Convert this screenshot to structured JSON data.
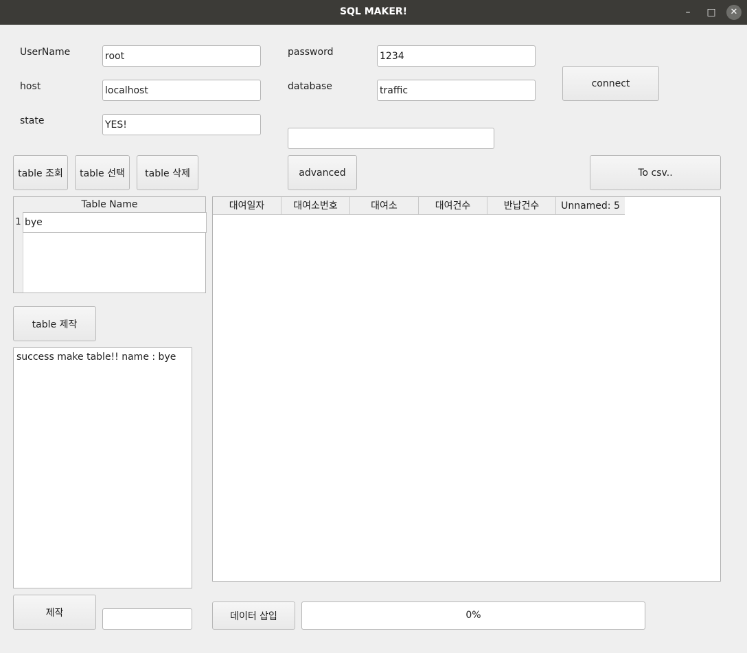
{
  "window": {
    "title": "SQL MAKER!",
    "minimize_glyph": "–",
    "maximize_glyph": "□",
    "close_glyph": "✕"
  },
  "connection": {
    "username_label": "UserName",
    "username_value": "root",
    "password_label": "password",
    "password_value": "1234",
    "host_label": "host",
    "host_value": "localhost",
    "database_label": "database",
    "database_value": "traffic",
    "state_label": "state",
    "state_value": "YES!",
    "connect_label": "connect",
    "query_value": ""
  },
  "toolbar": {
    "table_view_label": "table 조회",
    "table_select_label": "table 선택",
    "table_delete_label": "table 삭제",
    "advanced_label": "advanced",
    "to_csv_label": "To csv.."
  },
  "table_list": {
    "header": "Table Name",
    "rows": [
      {
        "index": "1",
        "name": "bye"
      }
    ]
  },
  "table_make_label": "table 제작",
  "log_text": "success make table!! name : bye",
  "make_label": "제작",
  "make_input_value": "",
  "data_grid": {
    "columns": [
      "대여일자",
      "대여소번호",
      "대여소",
      "대여건수",
      "반납건수",
      "Unnamed: 5"
    ]
  },
  "insert_label": "데이터 삽입",
  "progress": {
    "value": 0,
    "text": "0%"
  }
}
